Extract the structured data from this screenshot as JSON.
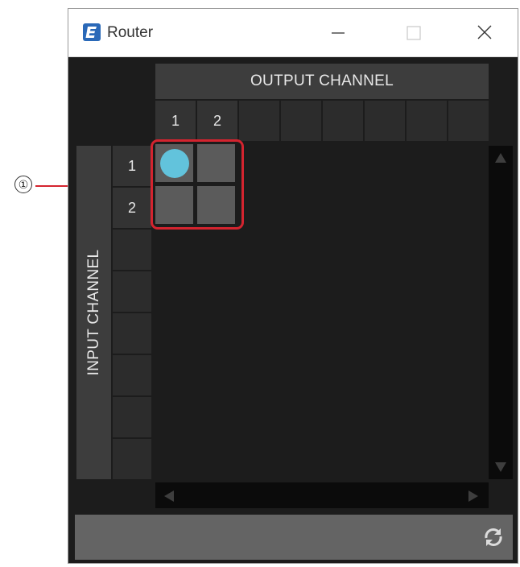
{
  "window": {
    "title": "Router",
    "app_icon": "app-logo-icon",
    "controls": [
      "minimize-icon",
      "maximize-icon",
      "close-icon"
    ]
  },
  "router": {
    "output_header": "OUTPUT CHANNEL",
    "input_header": "INPUT CHANNEL",
    "output_channels": [
      "1",
      "2"
    ],
    "input_channels": [
      "1",
      "2"
    ],
    "crosspoints": [
      {
        "input": "1",
        "output": "1",
        "active": true
      },
      {
        "input": "1",
        "output": "2",
        "active": false
      },
      {
        "input": "2",
        "output": "1",
        "active": false
      },
      {
        "input": "2",
        "output": "2",
        "active": false
      }
    ]
  },
  "annotation": {
    "label": "①"
  },
  "colors": {
    "background": "#1c1c1c",
    "header": "#3d3d3d",
    "crosspoint": "#5b5b5b",
    "active_dot": "#62c3dc",
    "highlight": "#d4242f",
    "footer": "#646464"
  },
  "icons": {
    "refresh": "refresh-icon",
    "scroll_up": "scroll-up-arrow-icon",
    "scroll_down": "scroll-down-arrow-icon",
    "scroll_left": "scroll-left-arrow-icon",
    "scroll_right": "scroll-right-arrow-icon"
  }
}
